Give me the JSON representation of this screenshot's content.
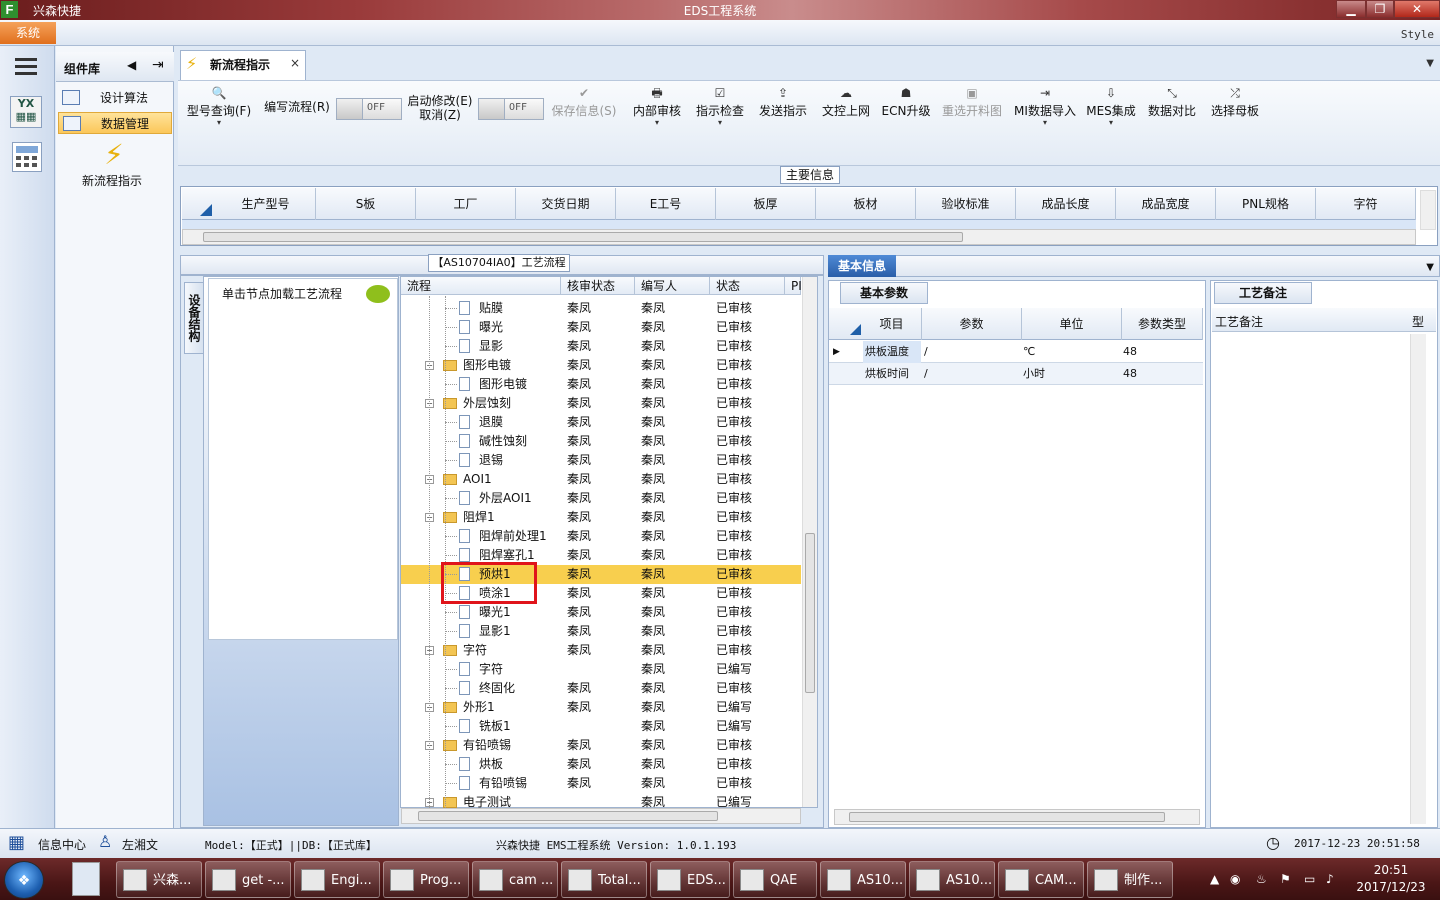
{
  "window": {
    "app_name": "兴森快捷",
    "title": "EDS工程系统",
    "min": "▁",
    "max": "❐",
    "close": "✕"
  },
  "menu": {
    "system": "系统",
    "style": "Style"
  },
  "component_panel": {
    "title": "组件库",
    "items": [
      "设计算法",
      "数据管理"
    ],
    "launcher": "新流程指示"
  },
  "doc_tab": {
    "label": "新流程指示",
    "close": "×"
  },
  "toolbar": {
    "buttons": [
      {
        "label": "型号查询(F)",
        "icon": "🔍",
        "dropdown": true
      },
      {
        "label": "编写流程(R)",
        "icon": "",
        "dropdown": false
      },
      {
        "label": "启动修改(E)",
        "label2": "取消(Z)",
        "icon": ""
      },
      {
        "label": "保存信息(S)",
        "icon": "✔"
      },
      {
        "label": "内部审核",
        "icon": "🖶",
        "dropdown": true
      },
      {
        "label": "指示检查",
        "icon": "☑",
        "dropdown": true
      },
      {
        "label": "发送指示",
        "icon": "⇪"
      },
      {
        "label": "文控上网",
        "icon": "☁"
      },
      {
        "label": "ECN升级",
        "icon": "☗"
      },
      {
        "label": "重选开料图",
        "icon": "▣"
      },
      {
        "label": "MI数据导入",
        "icon": "⇥",
        "dropdown": true
      },
      {
        "label": "MES集成",
        "icon": "⇩",
        "dropdown": true
      },
      {
        "label": "数据对比",
        "icon": "⤡"
      },
      {
        "label": "选择母板",
        "icon": "⤮"
      }
    ],
    "toggle_off": "OFF"
  },
  "main_info": {
    "title": "主要信息",
    "columns": [
      "生产型号",
      "S板",
      "工厂",
      "交货日期",
      "E工号",
      "板厚",
      "板材",
      "验收标准",
      "成品长度",
      "成品宽度",
      "PNL规格",
      "字符"
    ]
  },
  "process": {
    "title": "【AS10704IA0】工艺流程",
    "side_tab": "设备结构",
    "load_label": "单击节点加载工艺流程",
    "columns": [
      "流程",
      "核审状态",
      "编写人",
      "状态",
      "PI"
    ],
    "rows": [
      {
        "name": "贴膜",
        "type": "file",
        "level": 2,
        "review": "秦凤",
        "author": "秦凤",
        "status": "已审核"
      },
      {
        "name": "曝光",
        "type": "file",
        "level": 2,
        "review": "秦凤",
        "author": "秦凤",
        "status": "已审核"
      },
      {
        "name": "显影",
        "type": "file",
        "level": 2,
        "review": "秦凤",
        "author": "秦凤",
        "status": "已审核"
      },
      {
        "name": "图形电镀",
        "type": "folder",
        "level": 1,
        "review": "秦凤",
        "author": "秦凤",
        "status": "已审核"
      },
      {
        "name": "图形电镀",
        "type": "file",
        "level": 2,
        "review": "秦凤",
        "author": "秦凤",
        "status": "已审核"
      },
      {
        "name": "外层蚀刻",
        "type": "folder",
        "level": 1,
        "review": "秦凤",
        "author": "秦凤",
        "status": "已审核"
      },
      {
        "name": "退膜",
        "type": "file",
        "level": 2,
        "review": "秦凤",
        "author": "秦凤",
        "status": "已审核"
      },
      {
        "name": "碱性蚀刻",
        "type": "file",
        "level": 2,
        "review": "秦凤",
        "author": "秦凤",
        "status": "已审核"
      },
      {
        "name": "退锡",
        "type": "file",
        "level": 2,
        "review": "秦凤",
        "author": "秦凤",
        "status": "已审核"
      },
      {
        "name": "AOI1",
        "type": "folder",
        "level": 1,
        "review": "秦凤",
        "author": "秦凤",
        "status": "已审核"
      },
      {
        "name": "外层AOI1",
        "type": "file",
        "level": 2,
        "review": "秦凤",
        "author": "秦凤",
        "status": "已审核"
      },
      {
        "name": "阻焊1",
        "type": "folder",
        "level": 1,
        "review": "秦凤",
        "author": "秦凤",
        "status": "已审核"
      },
      {
        "name": "阻焊前处理1",
        "type": "file",
        "level": 2,
        "review": "秦凤",
        "author": "秦凤",
        "status": "已审核"
      },
      {
        "name": "阻焊塞孔1",
        "type": "file",
        "level": 2,
        "review": "秦凤",
        "author": "秦凤",
        "status": "已审核"
      },
      {
        "name": "预烘1",
        "type": "file",
        "level": 2,
        "review": "秦凤",
        "author": "秦凤",
        "status": "已审核",
        "selected": true
      },
      {
        "name": "喷涂1",
        "type": "file",
        "level": 2,
        "review": "秦凤",
        "author": "秦凤",
        "status": "已审核"
      },
      {
        "name": "曝光1",
        "type": "file",
        "level": 2,
        "review": "秦凤",
        "author": "秦凤",
        "status": "已审核"
      },
      {
        "name": "显影1",
        "type": "file",
        "level": 2,
        "review": "秦凤",
        "author": "秦凤",
        "status": "已审核"
      },
      {
        "name": "字符",
        "type": "folder",
        "level": 1,
        "review": "秦凤",
        "author": "秦凤",
        "status": "已审核"
      },
      {
        "name": "字符",
        "type": "file",
        "level": 2,
        "review": "",
        "author": "秦凤",
        "status": "已编写"
      },
      {
        "name": "终固化",
        "type": "file",
        "level": 2,
        "review": "秦凤",
        "author": "秦凤",
        "status": "已审核"
      },
      {
        "name": "外形1",
        "type": "folder",
        "level": 1,
        "review": "秦凤",
        "author": "秦凤",
        "status": "已编写"
      },
      {
        "name": "铣板1",
        "type": "file",
        "level": 2,
        "review": "",
        "author": "秦凤",
        "status": "已编写"
      },
      {
        "name": "有铅喷锡",
        "type": "folder",
        "level": 1,
        "review": "秦凤",
        "author": "秦凤",
        "status": "已审核"
      },
      {
        "name": "烘板",
        "type": "file",
        "level": 2,
        "review": "秦凤",
        "author": "秦凤",
        "status": "已审核"
      },
      {
        "name": "有铅喷锡",
        "type": "file",
        "level": 2,
        "review": "秦凤",
        "author": "秦凤",
        "status": "已审核"
      },
      {
        "name": "电子测试",
        "type": "folder",
        "level": 1,
        "review": "",
        "author": "秦凤",
        "status": "已编写"
      }
    ]
  },
  "basic_info": {
    "tab": "基本信息",
    "param_tab": "基本参数",
    "param_columns": [
      "项目",
      "参数",
      "单位",
      "参数类型"
    ],
    "params": [
      {
        "item": "烘板温度",
        "value": "/",
        "unit": "℃",
        "type": "48"
      },
      {
        "item": "烘板时间",
        "value": "/",
        "unit": "小时",
        "type": "48"
      }
    ],
    "note_tab": "工艺备注",
    "note_columns": [
      "工艺备注",
      "型"
    ]
  },
  "status": {
    "info_center": "信息中心",
    "user": "左湘文",
    "model_db": "Model:【正式】||DB:【正式库】",
    "version": "兴森快捷 EMS工程系统 Version: 1.0.1.193",
    "datetime": "2017-12-23 20:51:58"
  },
  "taskbar": {
    "items": [
      "兴森...",
      "get -...",
      "Engi...",
      "Prog...",
      "cam ...",
      "Total...",
      "EDS...",
      "QAE",
      "AS10...",
      "AS10...",
      "CAM...",
      "制作..."
    ],
    "time": "20:51",
    "date": "2017/12/23"
  }
}
